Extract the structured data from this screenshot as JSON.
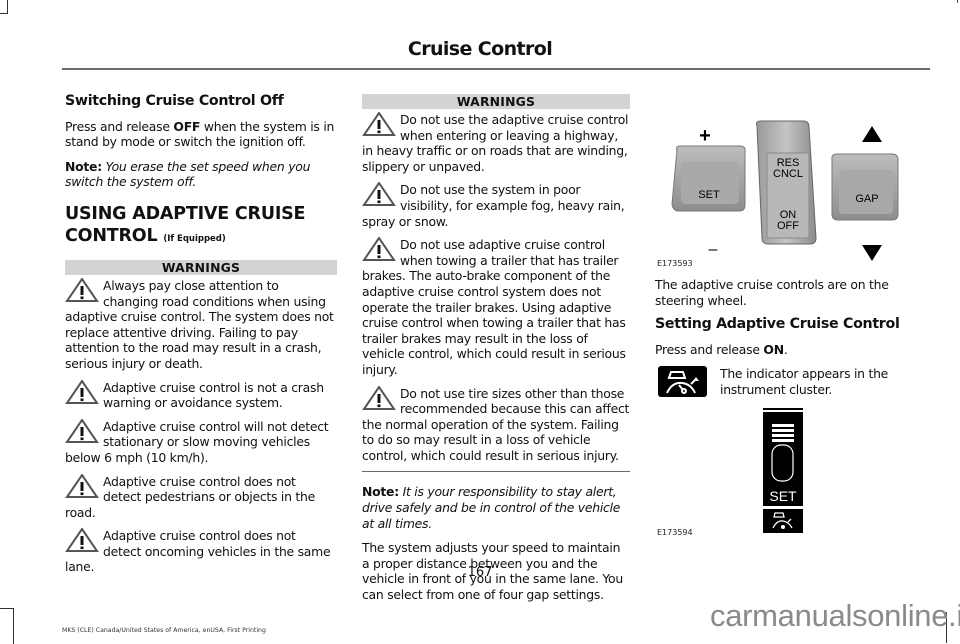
{
  "header": {
    "title": "Cruise Control"
  },
  "column1": {
    "section_heading": "Switching Cruise Control Off",
    "intro": {
      "before": "Press and release ",
      "bold": "OFF",
      "after": " when the system is in stand by mode or switch the ignition off."
    },
    "note": {
      "label": "Note:",
      "text": " You erase the set speed when you switch the system off."
    },
    "chapter_heading": "USING ADAPTIVE CRUISE CONTROL",
    "chapter_qualifier": "(If Equipped)",
    "warnings_title": "WARNINGS",
    "warnings": [
      "Always pay close attention to changing road conditions when using adaptive cruise control. The system does not replace attentive driving. Failing to pay attention to the road may result in a crash, serious injury or death.",
      "Adaptive cruise control is not a crash warning or avoidance system.",
      "Adaptive cruise control will not detect stationary or slow moving vehicles below 6 mph (10 km/h).",
      "Adaptive cruise control does not detect pedestrians or objects in the road.",
      "Adaptive cruise control does not detect oncoming vehicles in the same lane."
    ]
  },
  "column2": {
    "warnings_title": "WARNINGS",
    "warnings": [
      "Do not use the adaptive cruise control when entering or leaving a highway, in heavy traffic or on roads that are winding, slippery or unpaved.",
      "Do not use the system in poor visibility, for example fog, heavy rain, spray or snow.",
      "Do not use adaptive cruise control when towing a trailer that has trailer brakes. The auto-brake component of the adaptive cruise control system does not operate the trailer brakes. Using adaptive cruise control when towing a trailer that has trailer brakes may result in the loss of vehicle control, which could result in serious injury.",
      "Do not use tire sizes other than those recommended because this can affect the normal operation of the system. Failing to do so may result in a loss of vehicle control, which could result in serious injury."
    ],
    "note": {
      "label": "Note:",
      "text": " It is your responsibility to stay alert, drive safely and be in control of the vehicle at all times."
    },
    "paragraph": "The system adjusts your speed to maintain a proper distance between you and the vehicle in front of you in the same lane. You can select from one of four gap settings."
  },
  "column3": {
    "figure1": {
      "id": "E173593",
      "labels": {
        "plus": "+",
        "minus": "–",
        "set": "SET",
        "res": "RES",
        "cncl": "CNCL",
        "on": "ON",
        "off": "OFF",
        "gap": "GAP"
      }
    },
    "caption": "The adaptive cruise controls are on the steering wheel.",
    "section_heading": "Setting Adaptive Cruise Control",
    "press": {
      "before": "Press and release ",
      "bold": "ON",
      "after": "."
    },
    "indicator_text": "The indicator appears in the instrument cluster.",
    "figure2": {
      "id": "E173594",
      "set_label": "SET"
    }
  },
  "footer": {
    "page_number": "167",
    "print_info": "MKS (CLE) Canada/United States of America, enUSA, First Printing",
    "watermark": "carmanualsonline.info"
  }
}
